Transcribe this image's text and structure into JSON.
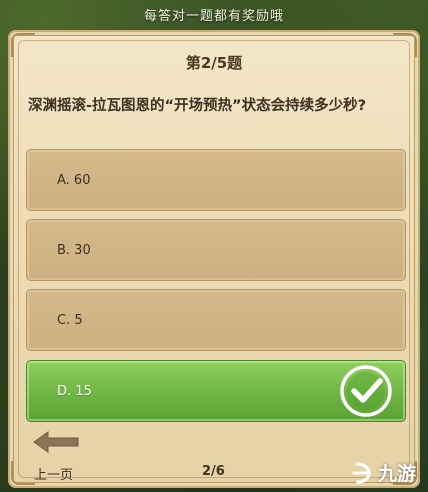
{
  "banner": {
    "text": "每答对一题都有奖励哦"
  },
  "quiz": {
    "progress_title": "第2/5题",
    "question": "深渊摇滚-拉瓦图恩的“开场预热”状态会持续多少秒?",
    "options": [
      {
        "label": "A. 60",
        "state": "default"
      },
      {
        "label": "B. 30",
        "state": "default"
      },
      {
        "label": "C. 5",
        "state": "default"
      },
      {
        "label": "D. 15",
        "state": "correct"
      }
    ]
  },
  "footer": {
    "prev_label": "上一页",
    "page_indicator": "2/6"
  },
  "watermark": {
    "text": "九游",
    "icon": "jiuyou-logo-icon"
  },
  "colors": {
    "parchment": "#eddcb5",
    "option_default": "#d4b98b",
    "option_correct": "#6fb544",
    "text_dark": "#3e3020"
  }
}
